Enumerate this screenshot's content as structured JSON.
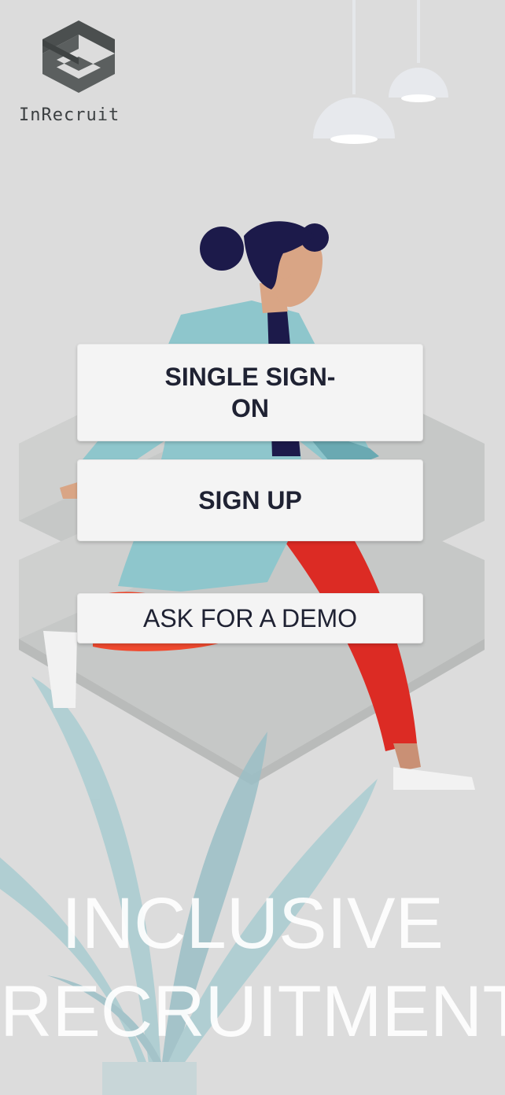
{
  "app": {
    "logo_text": "InRecruit",
    "icons": [
      "inrecruit-logo-icon",
      "pendant-lamp-icon",
      "person-illustration",
      "stairs-illustration",
      "plant-illustration"
    ]
  },
  "actions": {
    "sso_label": "SINGLE SIGN-ON",
    "signup_label": "SIGN UP",
    "demo_label": "ASK FOR A DEMO"
  },
  "tagline": {
    "line1": "INCLUSIVE",
    "line2": "RECRUITMENT"
  },
  "colors": {
    "background": "#dcdcdc",
    "button_background": "#f4f4f4",
    "button_text": "#1f2233",
    "jacket": "#8ec6cc",
    "pants": "#dc2b24",
    "hair": "#1c1a4a",
    "skin": "#d9a585",
    "plant": "#a9ccd1",
    "stairs": "#c7c9c8",
    "logo": "#4b4f4f"
  }
}
